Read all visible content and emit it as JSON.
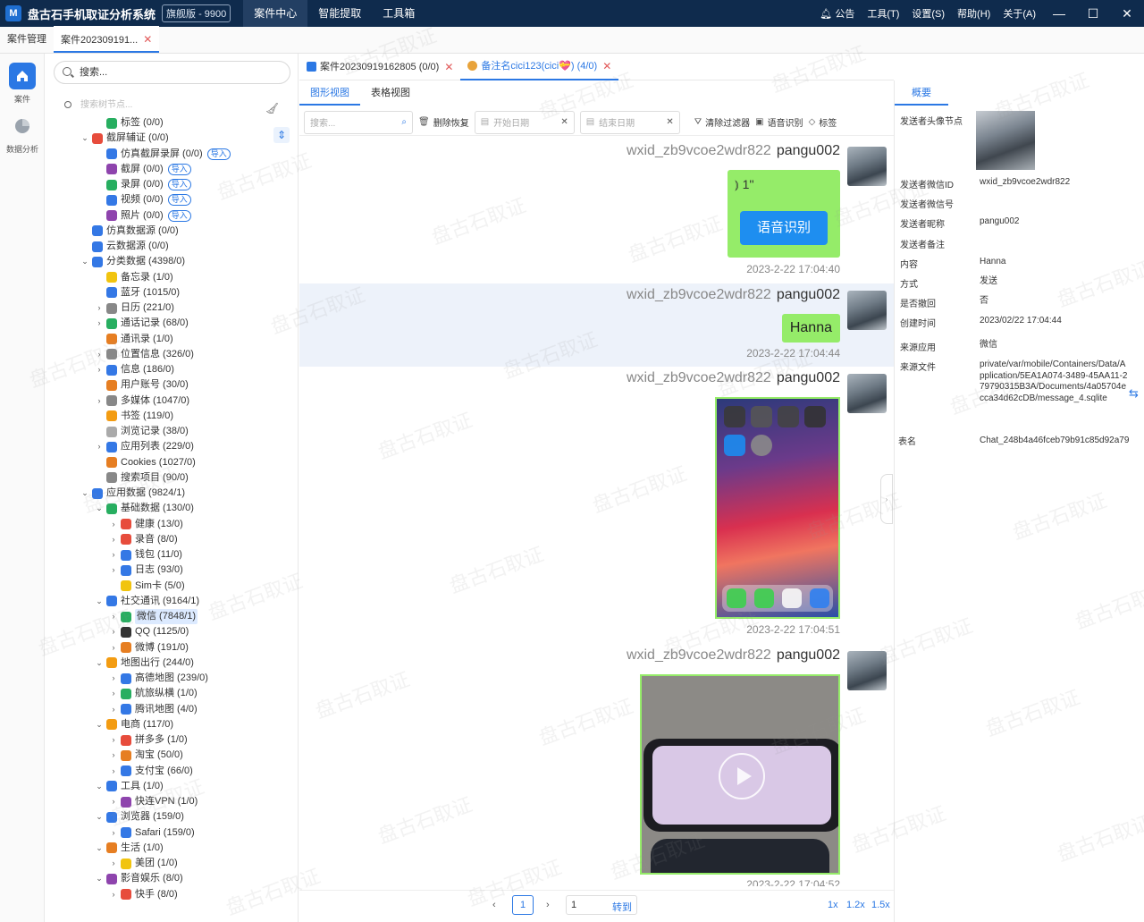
{
  "app": {
    "logo": "M",
    "title": "盘古石手机取证分析系统",
    "edition": "旗舰版 - 9900"
  },
  "main_menu": [
    "案件中心",
    "智能提取",
    "工具箱"
  ],
  "right_menu": [
    "公告",
    "工具(T)",
    "设置(S)",
    "帮助(H)",
    "关于(A)"
  ],
  "doc_tabs": [
    {
      "label": "案件管理"
    },
    {
      "label": "案件202309191..."
    }
  ],
  "nav": {
    "items": [
      {
        "label": "案件"
      },
      {
        "label": "数据分析"
      }
    ]
  },
  "tree": {
    "search_placeholder": "搜索...",
    "node_search_placeholder": "搜索树节点...",
    "import_label": "导入",
    "nodes": [
      {
        "label": "标签 (0/0)",
        "indent": 1,
        "caret": "",
        "color": "#27ae60",
        "import": false
      },
      {
        "label": "截屏辅证 (0/0)",
        "indent": 0,
        "caret": "⌄",
        "color": "#e74c3c",
        "import": false
      },
      {
        "label": "仿真截屏录屏 (0/0)",
        "indent": 1,
        "caret": "",
        "color": "#3478e5",
        "import": true
      },
      {
        "label": "截屏 (0/0)",
        "indent": 1,
        "caret": "",
        "color": "#8e44ad",
        "import": true
      },
      {
        "label": "录屏 (0/0)",
        "indent": 1,
        "caret": "",
        "color": "#27ae60",
        "import": true
      },
      {
        "label": "视频 (0/0)",
        "indent": 1,
        "caret": "",
        "color": "#3478e5",
        "import": true
      },
      {
        "label": "照片 (0/0)",
        "indent": 1,
        "caret": "",
        "color": "#8e44ad",
        "import": true
      },
      {
        "label": "仿真数据源 (0/0)",
        "indent": 0,
        "caret": "",
        "color": "#3478e5",
        "import": false
      },
      {
        "label": "云数据源 (0/0)",
        "indent": 0,
        "caret": "",
        "color": "#3478e5",
        "import": false
      },
      {
        "label": "分类数据 (4398/0)",
        "indent": 0,
        "caret": "⌄",
        "color": "#3478e5",
        "import": false
      },
      {
        "label": "备忘录 (1/0)",
        "indent": 1,
        "caret": "",
        "color": "#f1c40f",
        "import": false
      },
      {
        "label": "蓝牙 (1015/0)",
        "indent": 1,
        "caret": "",
        "color": "#3478e5",
        "import": false
      },
      {
        "label": "日历 (221/0)",
        "indent": 1,
        "caret": "›",
        "color": "#888",
        "import": false
      },
      {
        "label": "通话记录 (68/0)",
        "indent": 1,
        "caret": "›",
        "color": "#27ae60",
        "import": false
      },
      {
        "label": "通讯录 (1/0)",
        "indent": 1,
        "caret": "",
        "color": "#e67e22",
        "import": false
      },
      {
        "label": "位置信息 (326/0)",
        "indent": 1,
        "caret": "›",
        "color": "#888",
        "import": false
      },
      {
        "label": "信息 (186/0)",
        "indent": 1,
        "caret": "›",
        "color": "#3478e5",
        "import": false
      },
      {
        "label": "用户账号 (30/0)",
        "indent": 1,
        "caret": "",
        "color": "#e67e22",
        "import": false
      },
      {
        "label": "多媒体 (1047/0)",
        "indent": 1,
        "caret": "›",
        "color": "#888",
        "import": false
      },
      {
        "label": "书签 (119/0)",
        "indent": 1,
        "caret": "",
        "color": "#f39c12",
        "import": false
      },
      {
        "label": "浏览记录 (38/0)",
        "indent": 1,
        "caret": "",
        "color": "#aaa",
        "import": false
      },
      {
        "label": "应用列表 (229/0)",
        "indent": 1,
        "caret": "›",
        "color": "#3478e5",
        "import": false
      },
      {
        "label": "Cookies (1027/0)",
        "indent": 1,
        "caret": "",
        "color": "#e67e22",
        "import": false
      },
      {
        "label": "搜索项目 (90/0)",
        "indent": 1,
        "caret": "",
        "color": "#888",
        "import": false
      },
      {
        "label": "应用数据 (9824/1)",
        "indent": 0,
        "caret": "⌄",
        "color": "#3478e5",
        "import": false
      },
      {
        "label": "基础数据 (130/0)",
        "indent": 1,
        "caret": "⌄",
        "color": "#27ae60",
        "import": false
      },
      {
        "label": "健康 (13/0)",
        "indent": 2,
        "caret": "›",
        "color": "#e74c3c",
        "import": false
      },
      {
        "label": "录音 (8/0)",
        "indent": 2,
        "caret": "›",
        "color": "#e74c3c",
        "import": false
      },
      {
        "label": "钱包 (11/0)",
        "indent": 2,
        "caret": "›",
        "color": "#3478e5",
        "import": false
      },
      {
        "label": "日志 (93/0)",
        "indent": 2,
        "caret": "›",
        "color": "#3478e5",
        "import": false
      },
      {
        "label": "Sim卡 (5/0)",
        "indent": 2,
        "caret": "",
        "color": "#f1c40f",
        "import": false
      },
      {
        "label": "社交通讯 (9164/1)",
        "indent": 1,
        "caret": "⌄",
        "color": "#3478e5",
        "import": false
      },
      {
        "label": "微信 (7848/1)",
        "indent": 2,
        "caret": "›",
        "color": "#27ae60",
        "import": false,
        "highlight": true
      },
      {
        "label": "QQ (1125/0)",
        "indent": 2,
        "caret": "›",
        "color": "#333",
        "import": false
      },
      {
        "label": "微博 (191/0)",
        "indent": 2,
        "caret": "›",
        "color": "#e67e22",
        "import": false
      },
      {
        "label": "地图出行 (244/0)",
        "indent": 1,
        "caret": "⌄",
        "color": "#f39c12",
        "import": false
      },
      {
        "label": "高德地图 (239/0)",
        "indent": 2,
        "caret": "›",
        "color": "#3478e5",
        "import": false
      },
      {
        "label": "航旅纵横 (1/0)",
        "indent": 2,
        "caret": "›",
        "color": "#27ae60",
        "import": false
      },
      {
        "label": "腾讯地图 (4/0)",
        "indent": 2,
        "caret": "›",
        "color": "#3478e5",
        "import": false
      },
      {
        "label": "电商 (117/0)",
        "indent": 1,
        "caret": "⌄",
        "color": "#f39c12",
        "import": false
      },
      {
        "label": "拼多多 (1/0)",
        "indent": 2,
        "caret": "›",
        "color": "#e74c3c",
        "import": false
      },
      {
        "label": "淘宝 (50/0)",
        "indent": 2,
        "caret": "›",
        "color": "#e67e22",
        "import": false
      },
      {
        "label": "支付宝 (66/0)",
        "indent": 2,
        "caret": "›",
        "color": "#3478e5",
        "import": false
      },
      {
        "label": "工具 (1/0)",
        "indent": 1,
        "caret": "⌄",
        "color": "#3478e5",
        "import": false
      },
      {
        "label": "快连VPN (1/0)",
        "indent": 2,
        "caret": "›",
        "color": "#8e44ad",
        "import": false
      },
      {
        "label": "浏览器 (159/0)",
        "indent": 1,
        "caret": "⌄",
        "color": "#3478e5",
        "import": false
      },
      {
        "label": "Safari (159/0)",
        "indent": 2,
        "caret": "›",
        "color": "#3478e5",
        "import": false
      },
      {
        "label": "生活 (1/0)",
        "indent": 1,
        "caret": "⌄",
        "color": "#e67e22",
        "import": false
      },
      {
        "label": "美团 (1/0)",
        "indent": 2,
        "caret": "›",
        "color": "#f1c40f",
        "import": false
      },
      {
        "label": "影音娱乐 (8/0)",
        "indent": 1,
        "caret": "⌄",
        "color": "#8e44ad",
        "import": false
      },
      {
        "label": "快手 (8/0)",
        "indent": 2,
        "caret": "›",
        "color": "#e74c3c",
        "import": false
      }
    ]
  },
  "center_tabs": [
    {
      "label": "案件20230919162805 (0/0)"
    },
    {
      "label": "备注名cici123(cici💝) (4/0)"
    }
  ],
  "view_tabs": [
    "图形视图",
    "表格视图"
  ],
  "filter": {
    "search_placeholder": "搜索...",
    "delete_restore": "删除恢复",
    "start_date": "开始日期",
    "end_date": "结束日期",
    "clear_filter": "清除过滤器",
    "speech_recognition": "语音识别",
    "tag": "标签"
  },
  "messages": [
    {
      "sender_id": "wxid_zb9vcoe2wdr822",
      "nickname": "pangu002",
      "type": "voice",
      "duration": "1''",
      "asr_button": "语音识别",
      "time": "2023-2-22 17:04:40"
    },
    {
      "sender_id": "wxid_zb9vcoe2wdr822",
      "nickname": "pangu002",
      "type": "text",
      "text": "Hanna",
      "time": "2023-2-22 17:04:44",
      "selected": true
    },
    {
      "sender_id": "wxid_zb9vcoe2wdr822",
      "nickname": "pangu002",
      "type": "image",
      "time": "2023-2-22 17:04:51"
    },
    {
      "sender_id": "wxid_zb9vcoe2wdr822",
      "nickname": "pangu002",
      "type": "video",
      "time": "2023-2-22 17:04:52"
    }
  ],
  "pager": {
    "current": "1",
    "input": "1",
    "go": "转到",
    "zooms": [
      "1x",
      "1.2x",
      "1.5x"
    ]
  },
  "detail": {
    "tab": "概要",
    "rows": [
      {
        "label": "发送者头像节点",
        "value": ""
      },
      {
        "label": "发送者微信ID",
        "value": "wxid_zb9vcoe2wdr822"
      },
      {
        "label": "发送者微信号",
        "value": ""
      },
      {
        "label": "发送者昵称",
        "value": "pangu002"
      },
      {
        "label": "发送者备注",
        "value": ""
      },
      {
        "label": "内容",
        "value": "Hanna"
      },
      {
        "label": "方式",
        "value": "发送"
      },
      {
        "label": "是否撤回",
        "value": "否"
      },
      {
        "label": "创建时间",
        "value": "2023/02/22 17:04:44"
      },
      {
        "label": "来源应用",
        "value": "微信"
      },
      {
        "label": "来源文件",
        "value": "private/var/mobile/Containers/Data/Application/5EA1A074-3489-45AA11-279790315B3A/Documents/4a05704ecca34d62cDB/message_4.sqlite"
      },
      {
        "label": "表名",
        "value": "Chat_248b4a46fceb79b91c85d92a79"
      }
    ]
  },
  "watermark_text": "盘古石取证",
  "colors": {
    "titlebar": "#0f2b4d",
    "accent": "#2b78e4",
    "bubble": "#95ec69",
    "asr": "#1e8ef0"
  }
}
